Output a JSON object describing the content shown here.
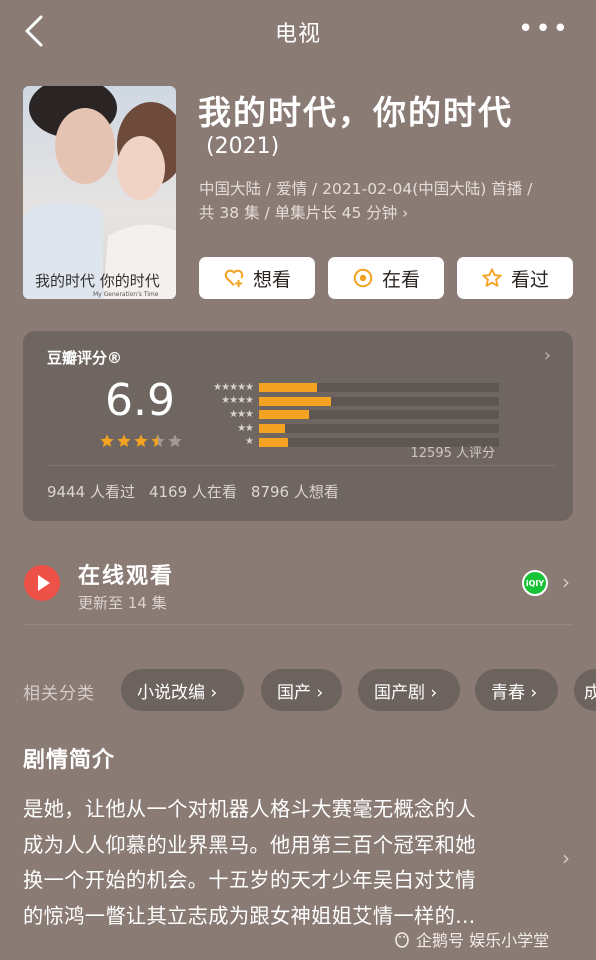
{
  "header": {
    "title": "电视",
    "more": "•••"
  },
  "movie": {
    "title": "我的时代，你的时代",
    "year": "(2021)",
    "meta_line1": "中国大陆 / 爱情 / 2021-02-04(中国大陆) 首播 /",
    "meta_line2": "共 38 集 / 单集片长 45 分钟 ›",
    "poster_title": "我的时代 你的时代",
    "poster_subtitle": "My Generation's Time"
  },
  "actions": [
    {
      "label": "想看",
      "icon": "heart-plus-icon"
    },
    {
      "label": "在看",
      "icon": "target-circle-icon"
    },
    {
      "label": "看过",
      "icon": "star-outline-icon"
    }
  ],
  "rating": {
    "card_title": "豆瓣评分®",
    "score": "6.9",
    "stars_value": 3.5,
    "distribution": [
      {
        "stars": "★★★★★",
        "percent": 24
      },
      {
        "stars": "★★★★",
        "percent": 30
      },
      {
        "stars": "★★★",
        "percent": 21
      },
      {
        "stars": "★★",
        "percent": 11
      },
      {
        "stars": "★",
        "percent": 12
      }
    ],
    "count": "12595 人评分",
    "stats": [
      "9444 人看过",
      "4169 人在看",
      "8796 人想看"
    ],
    "accent_color": "#f3a221"
  },
  "online": {
    "title": "在线观看",
    "subtitle": "更新至 14 集",
    "platform_badge": "iQIY",
    "play_color": "#ee5148"
  },
  "tags": {
    "label": "相关分类",
    "items": [
      "小说改编 ›",
      "国产 ›",
      "国产剧 ›",
      "青春 ›",
      "成"
    ]
  },
  "synopsis": {
    "title": "剧情简介",
    "lines": [
      "是她，让他从一个对机器人格斗大赛毫无概念的人",
      "成为人人仰慕的业界黑马。他用第三百个冠军和她",
      "换一个开始的机会。十五岁的天才少年吴白对艾情",
      "的惊鸿一瞥让其立志成为跟女神姐姐艾情一样的..."
    ]
  },
  "watermark": "企鹅号 娱乐小学堂"
}
